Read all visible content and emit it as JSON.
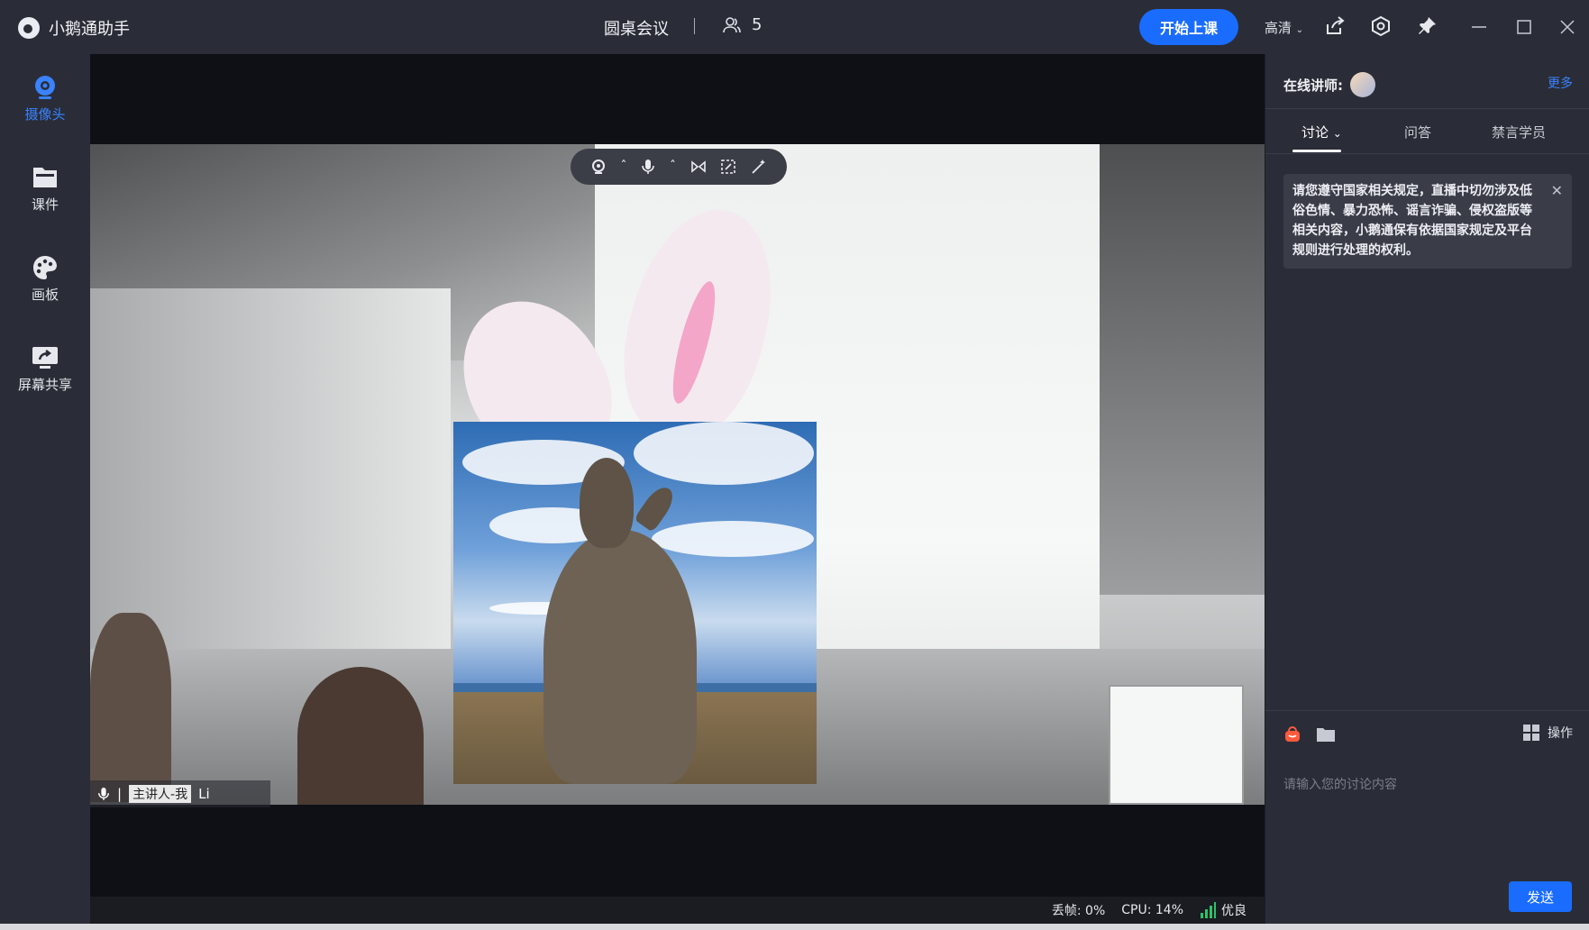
{
  "app": {
    "name": "小鹅通助手"
  },
  "header": {
    "meeting_title": "圆桌会议",
    "participant_count": "5",
    "start_button": "开始上课",
    "quality": "高清"
  },
  "sidebar": {
    "items": [
      {
        "label": "摄像头",
        "icon": "camera-icon",
        "active": true
      },
      {
        "label": "课件",
        "icon": "folder-icon",
        "active": false
      },
      {
        "label": "画板",
        "icon": "palette-icon",
        "active": false
      },
      {
        "label": "屏幕共享",
        "icon": "screen-share-icon",
        "active": false
      }
    ]
  },
  "video": {
    "speaker_tag": "主讲人-我",
    "speaker_name": "Li"
  },
  "status": {
    "dropped_label": "丢帧:",
    "dropped_value": "0%",
    "cpu": "CPU: 14%",
    "network": "优良"
  },
  "panel": {
    "teacher_label": "在线讲师:",
    "more": "更多",
    "tabs": [
      "讨论",
      "问答",
      "禁言学员"
    ],
    "notice": "请您遵守国家相关规定，直播中切勿涉及低俗色情、暴力恐怖、谣言诈骗、侵权盗版等相关内容，小鹅通保有依据国家规定及平台规则进行处理的权利。",
    "operation": "操作",
    "input_placeholder": "请输入您的讨论内容",
    "send": "发送"
  },
  "colors": {
    "accent": "#1a6cff",
    "bg": "#2a2d37"
  }
}
